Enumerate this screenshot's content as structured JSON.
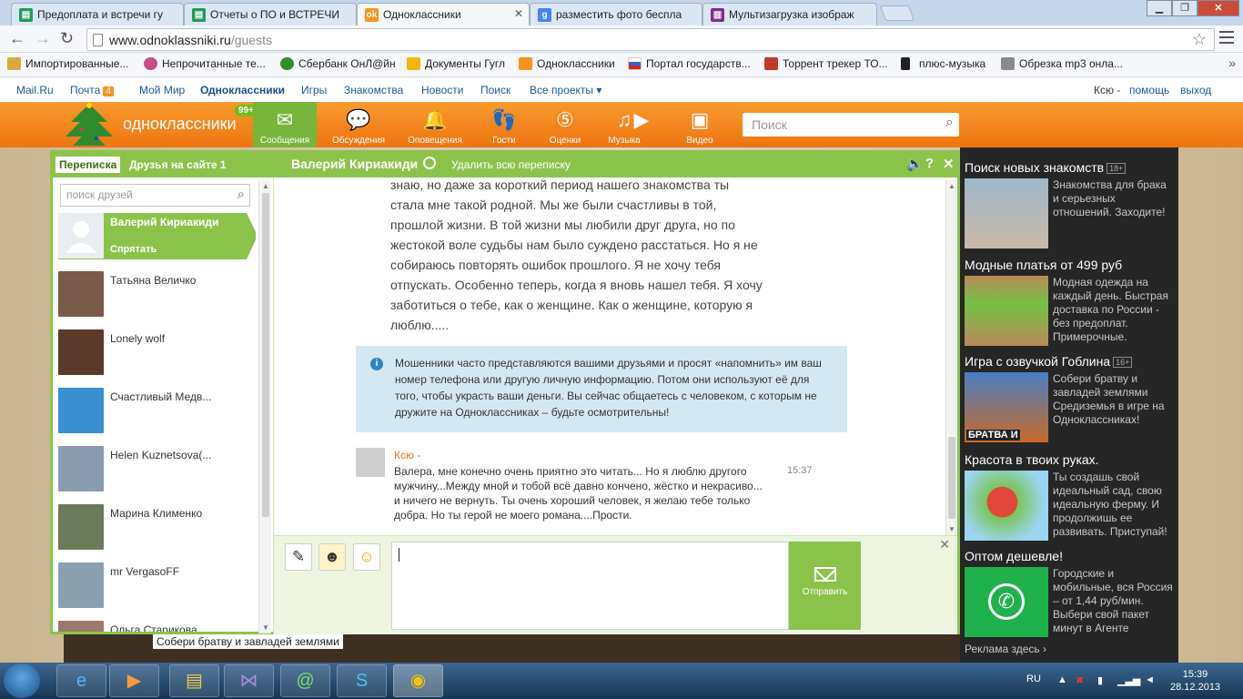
{
  "browser": {
    "tabs": [
      {
        "title": "Предоплата и встречи гу",
        "icon": "spreadsheet-icon",
        "color": "#1f9d55",
        "active": false
      },
      {
        "title": "Отчеты о ПО и ВСТРЕЧИ",
        "icon": "spreadsheet-icon",
        "color": "#1f9d55",
        "active": false
      },
      {
        "title": "Одноклассники",
        "icon": "ok-icon",
        "color": "#f7931e",
        "active": true
      },
      {
        "title": "разместить фото беспла",
        "icon": "google-icon",
        "color": "#4285f4",
        "active": false
      },
      {
        "title": "Мультизагрузка изображ",
        "icon": "stripes-icon",
        "color": "#7a2e8c",
        "active": false
      }
    ],
    "url_host": "www.odnoklassniki.ru",
    "url_path": "/guests",
    "bookmarks": [
      {
        "label": "Импортированные...",
        "icon": "folder-icon",
        "color": "#d9a93b"
      },
      {
        "label": "Непрочитанные те...",
        "icon": "flower-icon",
        "color": "#c94b8a"
      },
      {
        "label": "Сбербанк ОнЛ@йн",
        "icon": "sber-icon",
        "color": "#2f8f2f"
      },
      {
        "label": "Документы Гугл",
        "icon": "drive-icon",
        "color": "#f2b600"
      },
      {
        "label": "Одноклассники",
        "icon": "ok-icon",
        "color": "#f7931e"
      },
      {
        "label": "Портал государств...",
        "icon": "flag-icon",
        "color": "#3a5fcd"
      },
      {
        "label": "Торрент трекер ТО...",
        "icon": "torrent-icon",
        "color": "#c0392b"
      },
      {
        "label": "плюс-музыка",
        "icon": "phone-icon",
        "color": "#222222"
      },
      {
        "label": "Обрезка mp3 онла...",
        "icon": "page-icon",
        "color": "#8a8a8a"
      }
    ]
  },
  "mailbar": {
    "links": [
      "Mail.Ru",
      "Почта",
      "Мой Мир",
      "Одноклассники",
      "Игры",
      "Знакомства",
      "Новости",
      "Поиск",
      "Все проекты ▾"
    ],
    "mail_count": "4",
    "user": "Ксю",
    "help": "помощь",
    "logout": "выход"
  },
  "okheader": {
    "logo": "одноклассники",
    "badge": "99+",
    "nav": [
      {
        "label": "Сообщения",
        "icon": "envelope-icon",
        "glyph": "✉"
      },
      {
        "label": "Обсуждения",
        "icon": "chat-icon",
        "glyph": "💬"
      },
      {
        "label": "Оповещения",
        "icon": "bell-icon",
        "glyph": "🔔"
      },
      {
        "label": "Гости",
        "icon": "footprints-icon",
        "glyph": "👣"
      },
      {
        "label": "Оценки",
        "icon": "rating-icon",
        "glyph": "⑤"
      },
      {
        "label": "Музыка",
        "icon": "music-icon",
        "glyph": "♫"
      },
      {
        "label": "",
        "icon": "play-icon",
        "glyph": "▶"
      },
      {
        "label": "Видео",
        "icon": "video-icon",
        "glyph": "▣"
      }
    ],
    "search_placeholder": "Поиск"
  },
  "messenger": {
    "tab_active": "Переписка",
    "tab_friends": "Друзья на сайте 1",
    "contact_name": "Валерий Кириакиди",
    "delete_all": "Удалить всю переписку",
    "friend_search_placeholder": "поиск друзей",
    "friends": [
      {
        "name": "Валерий Кириакиди",
        "active": true,
        "hide": "Спрятать",
        "color": "#e9edf1"
      },
      {
        "name": "Татьяна Величко",
        "color": "#7a5a4a"
      },
      {
        "name": "Lonely wolf",
        "color": "#5a3a2a"
      },
      {
        "name": "Счастливый Медв...",
        "color": "#3a8fd0"
      },
      {
        "name": "Helen Kuznetsova(...",
        "color": "#8a9ab0"
      },
      {
        "name": "Марина Клименко",
        "color": "#6a7a5a"
      },
      {
        "name": "mr VergasoFF",
        "color": "#8aa0b0"
      },
      {
        "name": "Ольга Старикова",
        "color": "#9a7a6a"
      }
    ],
    "incoming_text": "знаю, но даже за короткий период нашего знакомства ты стала мне такой родной. Мы же были счастливы в той, прошлой жизни. В той жизни мы любили друг друга, но по жестокой воле судьбы нам было суждено расстаться. Но я не собираюсь повторять ошибок прошлого. Я не хочу тебя отпускать. Особенно теперь, когда я вновь нашел тебя. Я хочу заботиться о тебе, как о женщине. Как о женщине, которую я люблю.....",
    "warning": "Мошенники часто представляются вашими друзьями и просят «напомнить» им ваш номер телефона или другую личную информацию. Потом они используют её для того, чтобы украсть ваши деньги. Вы сейчас общаетесь с человеком, с которым не дружите на Одноклассниках – будьте осмотрительны!",
    "my_author": "Ксю -",
    "my_text": "Валера, мне конечно очень приятно это читать... Но я люблю другого мужчину...Между мной и тобой всё давно кончено, жёстко и некрасиво... и ничего не вернуть. Ты очень хороший человек, я желаю тебе только добра. Но ты герой не моего романа....Прости.",
    "my_time": "15:37",
    "send_label": "Отправить"
  },
  "ads": [
    {
      "title": "Поиск новых знакомств",
      "age": "18+",
      "text": "Знакомства для брака и серьезных отношений. Заходите!",
      "color": "#b9c3cc"
    },
    {
      "title": "Модные платья от 499 руб",
      "age": "",
      "text": "Модная одежда на каждый день. Быстрая доставка по России - без предоплат. Примерочные.",
      "color": "#76c043"
    },
    {
      "title": "Игра с озвучкой Гоблина",
      "age": "16+",
      "text": "Собери братву и завладей землями Средиземья в игре на Одноклассниках!",
      "color": "#4a7fc2",
      "img_caption": "БРАТВА И"
    },
    {
      "title": "Красота в твоих руках.",
      "age": "",
      "text": "Ты создашь свой идеальный сад, свою идеальную ферму. И продолжишь ее развивать. Приступай!",
      "color": "#e0463a"
    },
    {
      "title": "Оптом дешевле!",
      "age": "",
      "text": "Городские и мобильные, вся Россия – от 1,44 руб/мин. Выбери свой пакет минут в Агенте",
      "color": "#1fb14b"
    }
  ],
  "ads_more": "Реклама здесь ›",
  "bg_strip_text": "Собери братву и завладей землями",
  "taskbar": {
    "lang": "RU",
    "time": "15:39",
    "date": "28.12.2013"
  }
}
